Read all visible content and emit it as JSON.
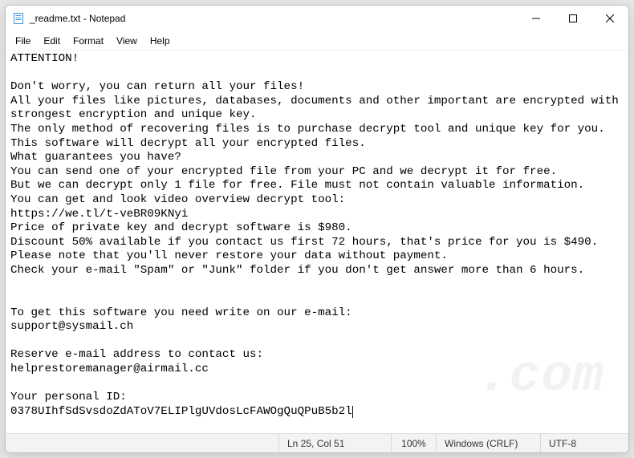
{
  "window": {
    "title": "_readme.txt - Notepad"
  },
  "menubar": {
    "items": [
      "File",
      "Edit",
      "Format",
      "View",
      "Help"
    ]
  },
  "document": {
    "text": "ATTENTION!\n\nDon't worry, you can return all your files!\nAll your files like pictures, databases, documents and other important are encrypted with strongest encryption and unique key.\nThe only method of recovering files is to purchase decrypt tool and unique key for you.\nThis software will decrypt all your encrypted files.\nWhat guarantees you have?\nYou can send one of your encrypted file from your PC and we decrypt it for free.\nBut we can decrypt only 1 file for free. File must not contain valuable information.\nYou can get and look video overview decrypt tool:\nhttps://we.tl/t-veBR09KNyi\nPrice of private key and decrypt software is $980.\nDiscount 50% available if you contact us first 72 hours, that's price for you is $490.\nPlease note that you'll never restore your data without payment.\nCheck your e-mail \"Spam\" or \"Junk\" folder if you don't get answer more than 6 hours.\n\n\nTo get this software you need write on our e-mail:\nsupport@sysmail.ch\n\nReserve e-mail address to contact us:\nhelprestoremanager@airmail.cc\n\nYour personal ID:\n0378UIhfSdSvsdoZdAToV7ELIPlgUVdosLcFAWOgQuQPuB5b2l"
  },
  "statusbar": {
    "position": "Ln 25, Col 51",
    "zoom": "100%",
    "eol": "Windows (CRLF)",
    "encoding": "UTF-8"
  },
  "watermark": ".com"
}
